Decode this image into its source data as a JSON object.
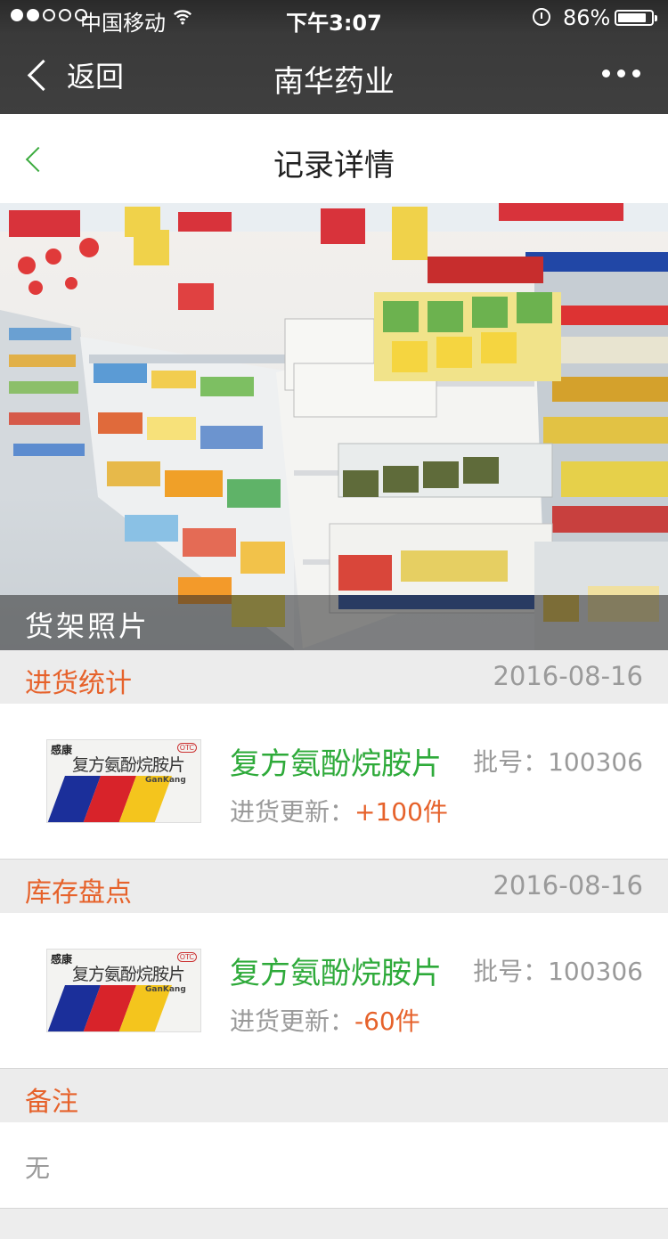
{
  "status_bar": {
    "carrier": "中国移动",
    "time": "下午3:07",
    "battery_percent": "86%",
    "battery_level": 0.86,
    "signal_bars": 2,
    "icons": [
      "signal-dots-icon",
      "wifi-icon",
      "alarm-icon",
      "battery-icon"
    ]
  },
  "nav": {
    "back_label": "返回",
    "title": "南华药业",
    "more_icon": "more-dots-icon"
  },
  "page_header": {
    "title": "记录详情",
    "back_icon": "chevron-left-icon"
  },
  "photo": {
    "caption": "货架照片"
  },
  "sections": {
    "purchase": {
      "label": "进货统计",
      "date": "2016-08-16",
      "item": {
        "thumb_brand": "感康",
        "thumb_name": "复方氨酚烷胺片",
        "thumb_badge": "OTC",
        "thumb_english": "GanKang",
        "name": "复方氨酚烷胺片",
        "batch": "批号：100306",
        "update_label": "进货更新：",
        "update_value": "+100件"
      }
    },
    "inventory": {
      "label": "库存盘点",
      "date": "2016-08-16",
      "item": {
        "thumb_brand": "感康",
        "thumb_name": "复方氨酚烷胺片",
        "thumb_badge": "OTC",
        "thumb_english": "GanKang",
        "name": "复方氨酚烷胺片",
        "batch": "批号：100306",
        "update_label": "进货更新：",
        "update_value": "-60件"
      }
    },
    "remarks": {
      "label": "备注",
      "content": "无"
    }
  },
  "colors": {
    "accent_green": "#2eaa3a",
    "accent_orange": "#e6622b",
    "nav_bg": "#3f3f3f",
    "muted_text": "#9a9a9a"
  }
}
